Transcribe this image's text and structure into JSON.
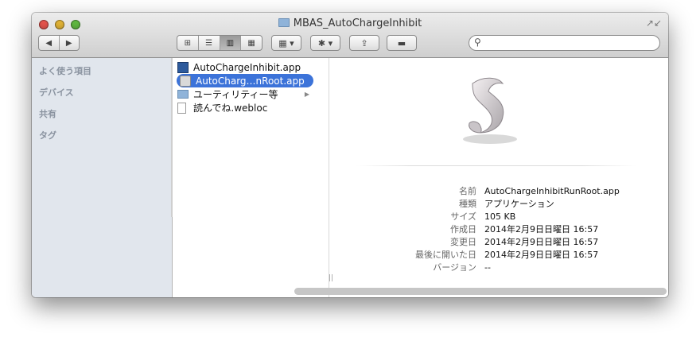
{
  "window": {
    "title": "MBAS_AutoChargeInhibit",
    "title_icon": "folder-icon",
    "resize_icon": "↗↙"
  },
  "toolbar": {
    "back_label": "◀",
    "forward_label": "▶",
    "view_icons": [
      "⊞",
      "☰",
      "▥",
      "▦"
    ],
    "arrange_label": "▦ ▾",
    "action_label": "✱ ▾",
    "share_label": "⇪",
    "tag_label": "▬",
    "search_placeholder": ""
  },
  "sidebar": {
    "sections": [
      "よく使う項目",
      "デバイス",
      "共有",
      "タグ"
    ]
  },
  "column": {
    "items": [
      {
        "label": "AutoChargeInhibit.app",
        "icon": "app-icon",
        "selected": false
      },
      {
        "label": "AutoCharg…nRoot.app",
        "icon": "script-app-icon",
        "selected": true
      },
      {
        "label": "ユーティリティー等",
        "icon": "folder-icon",
        "selected": false,
        "has_children": true
      },
      {
        "label": "読んでね.webloc",
        "icon": "document-icon",
        "selected": false
      }
    ],
    "grip": "||"
  },
  "preview": {
    "fields": [
      {
        "label": "名前",
        "value": "AutoChargeInhibitRunRoot.app"
      },
      {
        "label": "種類",
        "value": "アプリケーション"
      },
      {
        "label": "サイズ",
        "value": "105 KB"
      },
      {
        "label": "作成日",
        "value": "2014年2月9日日曜日 16:57"
      },
      {
        "label": "変更日",
        "value": "2014年2月9日日曜日 16:57"
      },
      {
        "label": "最後に開いた日",
        "value": "2014年2月9日日曜日 16:57"
      },
      {
        "label": "バージョン",
        "value": "--"
      }
    ]
  },
  "colors": {
    "selection": "#3c73d9",
    "sidebar_bg": "#e1e6ed",
    "close": "#e2524b",
    "minimize": "#dfb135",
    "zoom": "#5fb640"
  }
}
